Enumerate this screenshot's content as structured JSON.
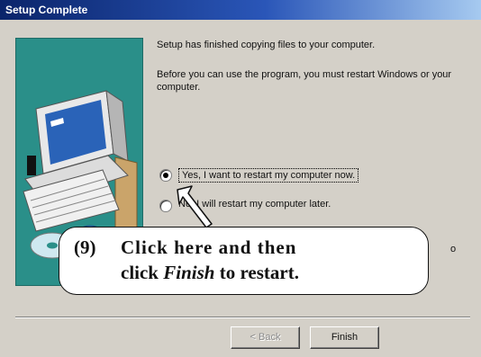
{
  "window": {
    "title": "Setup Complete"
  },
  "dialog": {
    "message1": "Setup has finished copying files to your computer.",
    "message2": "Before you can use the program, you must restart Windows or your computer.",
    "option_restart_now": "Yes, I want to restart my computer now.",
    "option_restart_later": "No, I will restart my computer later.",
    "selected_option": "option_restart_now",
    "back_label": "< Back",
    "finish_label": "Finish"
  },
  "callout": {
    "number": "(9)",
    "line1": "Click here and then",
    "line2_prefix": "click ",
    "line2_emphasis": "Finish",
    "line2_suffix": " to restart.",
    "note_tail": "o"
  },
  "colors": {
    "titlebar_start": "#0a246a",
    "titlebar_end": "#a6caf0",
    "banner": "#2a8f89",
    "dialog_face": "#d4d0c8"
  },
  "icons": [
    "computer-illustration-icon",
    "cd-disc-icon",
    "globe-icon",
    "pointer-arrow-icon"
  ]
}
